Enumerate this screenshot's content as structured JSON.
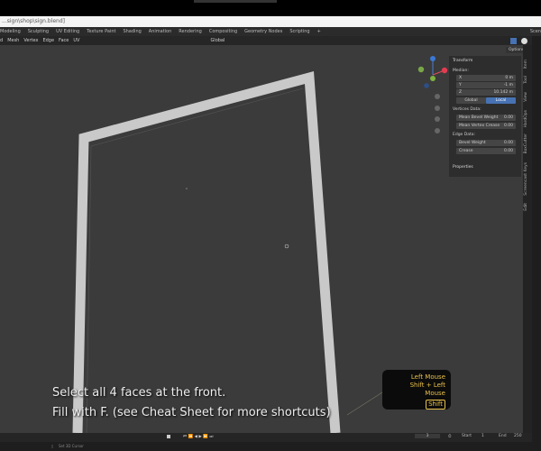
{
  "title_bar": {
    "path": "...sign\\shop\\sign.blend]"
  },
  "workspace_tabs": [
    "Modeling",
    "Sculpting",
    "UV Editing",
    "Texture Paint",
    "Shading",
    "Animation",
    "Rendering",
    "Compositing",
    "Geometry Nodes",
    "Scripting",
    "+"
  ],
  "scene_label": "Scen",
  "header": {
    "menus": [
      "d",
      "Mesh",
      "Vertex",
      "Edge",
      "Face",
      "UV"
    ],
    "orientation": "Global",
    "options": "Options",
    "axes": [
      "X",
      "Y",
      "Z"
    ]
  },
  "transform_panel": {
    "title": "Transform",
    "median": "Median:",
    "fields": [
      {
        "label": "X",
        "value": "0 m"
      },
      {
        "label": "Y",
        "value": "-1 m"
      },
      {
        "label": "Z",
        "value": "10.142 m"
      }
    ],
    "global": "Global",
    "local": "Local",
    "vertices_data": "Vertices Data:",
    "vertex_fields": [
      {
        "label": "Mean Bevel Weight",
        "value": "0.00"
      },
      {
        "label": "Mean Vertex Crease",
        "value": "0.00"
      }
    ],
    "edge_data": "Edge Data:",
    "edge_fields": [
      {
        "label": "Bevel Weight",
        "value": "0.00"
      },
      {
        "label": "Crease",
        "value": "0.00"
      }
    ],
    "properties": "Properties"
  },
  "sidebar_tabs": [
    "Item",
    "Tool",
    "View",
    "HardOps",
    "BoxCutter",
    "Screencast Keys",
    "Edit"
  ],
  "caption": {
    "line1": "Select all 4 faces at the front.",
    "line2": "Fill with F. (see Cheat Sheet for more shortcuts)"
  },
  "keys_overlay": {
    "line1": "Left Mouse",
    "line2": "Shift + Left Mouse",
    "key": "Shift"
  },
  "timeline": {
    "frame": "3",
    "start_label": "Start",
    "start": "1",
    "end_label": "End",
    "end": "250"
  },
  "status": {
    "text": "Set 3D Cursor"
  },
  "colors": {
    "accent": "#4772b3",
    "key_text": "#e8c04a"
  }
}
